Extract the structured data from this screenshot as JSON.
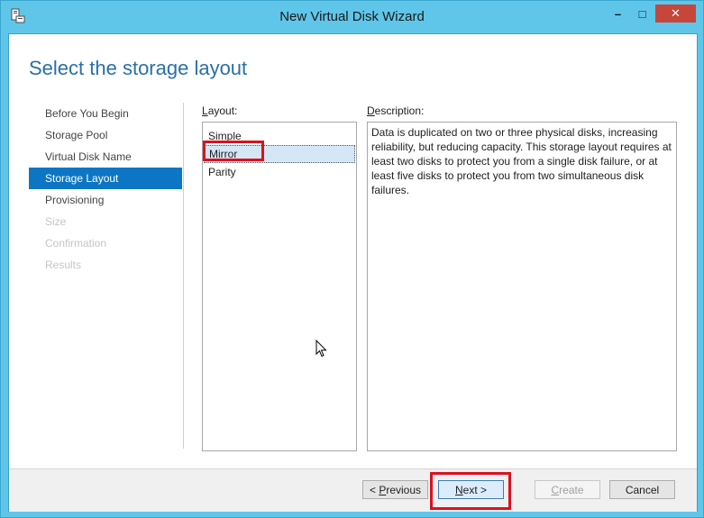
{
  "window": {
    "title": "New Virtual Disk Wizard",
    "controls": {
      "minimize": "–",
      "maximize": "□",
      "close": "✕"
    }
  },
  "page": {
    "heading": "Select the storage layout"
  },
  "nav": {
    "items": [
      {
        "label": "Before You Begin",
        "state": "normal"
      },
      {
        "label": "Storage Pool",
        "state": "normal"
      },
      {
        "label": "Virtual Disk Name",
        "state": "normal"
      },
      {
        "label": "Storage Layout",
        "state": "selected"
      },
      {
        "label": "Provisioning",
        "state": "normal"
      },
      {
        "label": "Size",
        "state": "disabled"
      },
      {
        "label": "Confirmation",
        "state": "disabled"
      },
      {
        "label": "Results",
        "state": "disabled"
      }
    ]
  },
  "layout": {
    "label_prefix": "L",
    "label_rest": "ayout:",
    "options": [
      {
        "label": "Simple"
      },
      {
        "label": "Mirror"
      },
      {
        "label": "Parity"
      }
    ],
    "selected": "Mirror"
  },
  "description": {
    "label_prefix": "D",
    "label_rest": "escription:",
    "text": "Data is duplicated on two or three physical disks, increasing reliability, but reducing capacity. This storage layout requires at least two disks to protect you from a single disk failure, or at least five disks to protect you from two simultaneous disk failures."
  },
  "buttons": {
    "previous_pre": "< ",
    "previous_mnemonic": "P",
    "previous_rest": "revious",
    "next_mnemonic": "N",
    "next_rest": "ext >",
    "create_mnemonic": "C",
    "create_rest": "reate",
    "cancel": "Cancel"
  },
  "colors": {
    "titlebar": "#5fc6ea",
    "heading": "#2a6fa8",
    "nav_selected": "#0d76c4",
    "highlight": "#d9121f",
    "close_button": "#c7463b"
  }
}
